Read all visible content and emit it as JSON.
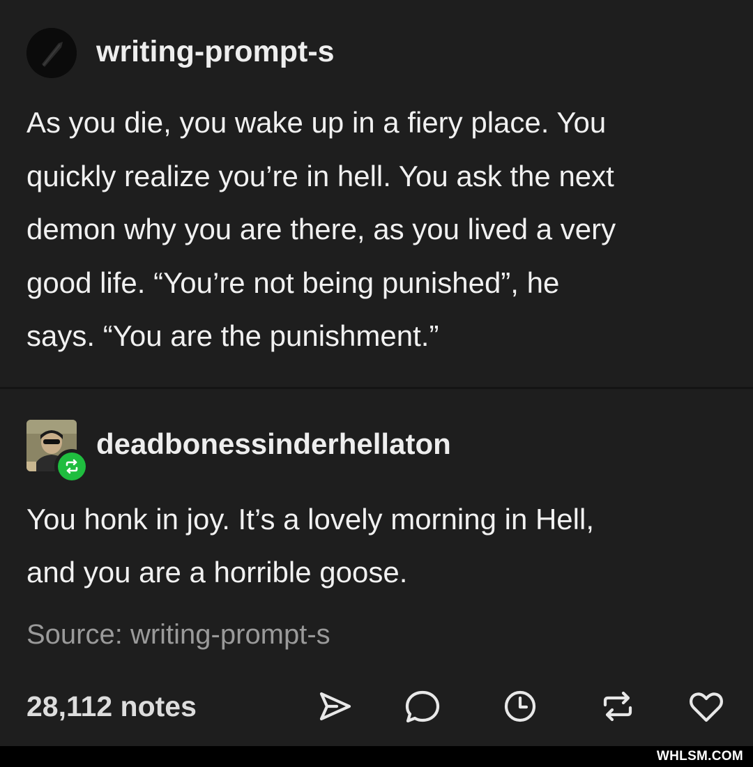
{
  "original_post": {
    "username": "writing-prompt-s",
    "avatar_icon": "quill-pen-icon",
    "body_lines": [
      "As you die, you wake up in a fiery place. You",
      "quickly realize you’re in hell. You ask the next",
      "demon why you are there, as you lived a very",
      "good life. “You’re not being punished”, he",
      "says. “You are the punishment.”"
    ]
  },
  "reblog": {
    "username": "deadbonessinderhellaton",
    "avatar_icon": "user-photo-avatar",
    "badge_icon": "reblog-icon",
    "badge_color": "#1fbd3f",
    "body_lines": [
      "You honk in joy. It’s a lovely morning in Hell,",
      "and you are a horrible goose."
    ]
  },
  "footer": {
    "source_label": "Source: writing-prompt-s",
    "notes_label": "28,112 notes",
    "actions": [
      {
        "name": "share-icon"
      },
      {
        "name": "reply-icon"
      },
      {
        "name": "schedule-icon"
      },
      {
        "name": "reblog-icon"
      },
      {
        "name": "heart-icon"
      }
    ]
  },
  "watermark": "WHLSM.COM",
  "colors": {
    "card_background": "#1e1e1e",
    "page_background": "#000000",
    "text_primary": "#f1f1f1",
    "text_muted": "#9a9a9a",
    "reblog_green": "#1fbd3f"
  }
}
